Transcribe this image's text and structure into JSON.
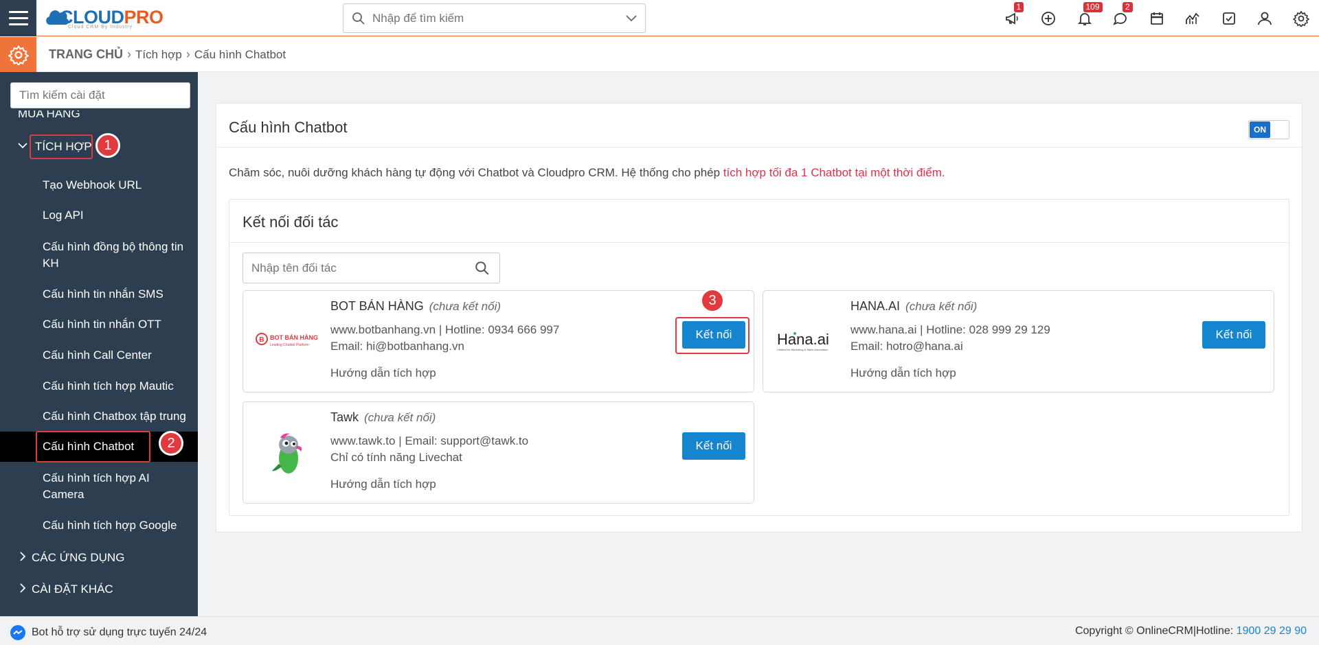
{
  "topbar": {
    "logo_cloud": "CLOUD",
    "logo_pro": "PRO",
    "logo_tagline": "Cloud CRM By Industry",
    "search_placeholder": "Nhập để tìm kiếm",
    "badges": {
      "announce": "1",
      "notifications": "109",
      "messages": "2"
    }
  },
  "breadcrumb": {
    "home": "TRANG CHỦ",
    "level1": "Tích hợp",
    "level2": "Cấu hình Chatbot"
  },
  "sidebar": {
    "search_placeholder": "Tìm kiếm cài đặt",
    "cut_item": "MUA HÀNG",
    "group_tichhop": "TÍCH HỢP",
    "items": [
      "Tạo Webhook URL",
      "Log API",
      "Cấu hình đồng bộ thông tin KH",
      "Cấu hình tin nhắn SMS",
      "Cấu hình tin nhắn OTT",
      "Cấu hình Call Center",
      "Cấu hình tích hợp Mautic",
      "Cấu hình Chatbox tập trung",
      "Cấu hình Chatbot",
      "Cấu hình tích hợp AI Camera",
      "Cấu hình tích hợp Google"
    ],
    "group_apps": "CÁC ỨNG DỤNG",
    "group_other": "CÀI ĐẶT KHÁC"
  },
  "steps": [
    "1",
    "2",
    "3"
  ],
  "main": {
    "title": "Cấu hình Chatbot",
    "toggle_label": "ON",
    "description": "Chăm sóc, nuôi dưỡng khách hàng tự động với Chatbot và Cloudpro CRM. Hệ thống cho phép ",
    "description_warn": "tích hợp tối đa 1 Chatbot tại một thời điểm.",
    "partners_title": "Kết nối đối tác",
    "partner_search_placeholder": "Nhập tên đối tác",
    "partners": [
      {
        "name": "BOT BÁN HÀNG",
        "status": "(chưa kết nối)",
        "line1": "www.botbanhang.vn | Hotline: 0934 666 997",
        "line2": "Email: hi@botbanhang.vn",
        "guide": "Hướng dẫn tích hợp",
        "button": "Kết nối",
        "logo_text": "BOT BÁN HÀNG",
        "logo_sub": "Leading Chatbot Platform"
      },
      {
        "name": "HANA.AI",
        "status": "(chưa kết nối)",
        "line1": "www.hana.ai | Hotline: 028 999 29 129",
        "line2": "Email: hotro@hana.ai",
        "guide": "Hướng dẫn tích hợp",
        "button": "Kết nối",
        "logo_text": "Hana.ai",
        "logo_sub": "Chatbot for Marketing & Sales Automation"
      },
      {
        "name": "Tawk",
        "status": "(chưa kết nối)",
        "line1": "www.tawk.to | Email: support@tawk.to",
        "line2": "Chỉ có tính năng Livechat",
        "guide": "Hướng dẫn tích hợp",
        "button": "Kết nối"
      }
    ]
  },
  "footer": {
    "left": "Bot hỗ trợ sử dụng trực tuyến 24/24",
    "right": "Copyright © OnlineCRM|Hotline: ",
    "hotline": "1900 29 29 90"
  },
  "colors": {
    "accent_orange": "#f0733a",
    "sidebar_bg": "#2d3e50",
    "button_blue": "#1685d0",
    "highlight_red": "#e0393e",
    "warn_text": "#d9334c"
  }
}
